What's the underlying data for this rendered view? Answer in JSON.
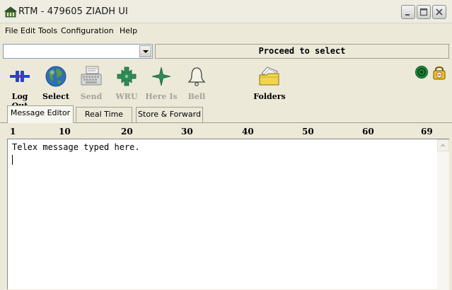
{
  "window": {
    "title": "RTM - 479605 ZIADH UI"
  },
  "menu": [
    "File",
    "Edit",
    "Tools",
    "Configuration",
    "Help"
  ],
  "destination_combo": {
    "value": ""
  },
  "status": {
    "text": "Proceed to select"
  },
  "toolbar": {
    "logout": "Log Out",
    "select": "Select",
    "send": "Send",
    "wru": "WRU",
    "here_is": "Here Is",
    "bell": "Bell",
    "folders": "Folders"
  },
  "tabs": [
    "Message Editor",
    "Real Time",
    "Store & Forward"
  ],
  "active_tab": "Message Editor",
  "ruler": [
    "1",
    "10",
    "20",
    "30",
    "40",
    "50",
    "60",
    "69"
  ],
  "editor": {
    "text": "Telex message typed here."
  },
  "colors": {
    "disabled_text": "#A5A39A",
    "globe_blue": "#2E6FB5",
    "folder_yellow": "#F2D54A",
    "plug_blue": "#2B43C8",
    "cross_green": "#2E8B57"
  }
}
